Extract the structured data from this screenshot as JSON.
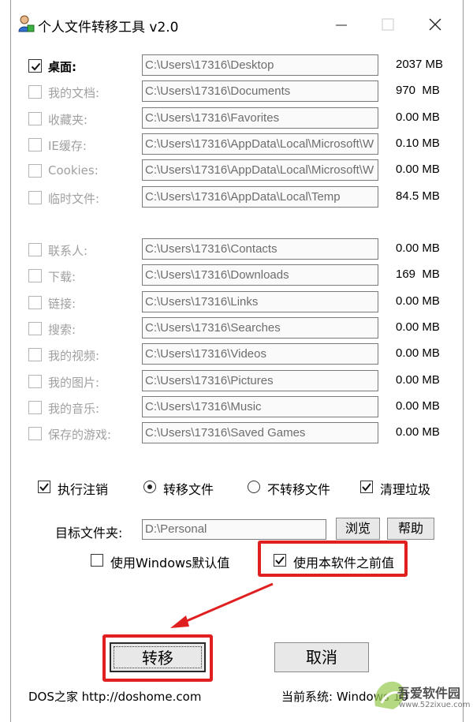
{
  "window": {
    "title": "个人文件转移工具 v2.0"
  },
  "folders_group1": [
    {
      "label": "桌面:",
      "path": "C:\\Users\\17316\\Desktop",
      "size": "2037 MB",
      "checked": true,
      "enabled": true
    },
    {
      "label": "我的文档:",
      "path": "C:\\Users\\17316\\Documents",
      "size": "970  MB",
      "checked": false,
      "enabled": false
    },
    {
      "label": "收藏夹:",
      "path": "C:\\Users\\17316\\Favorites",
      "size": "0.00 MB",
      "checked": false,
      "enabled": false
    },
    {
      "label": "IE缓存:",
      "path": "C:\\Users\\17316\\AppData\\Local\\Microsoft\\W",
      "size": "0.10 MB",
      "checked": false,
      "enabled": false
    },
    {
      "label": "Cookies:",
      "path": "C:\\Users\\17316\\AppData\\Local\\Microsoft\\W",
      "size": "0.00 MB",
      "checked": false,
      "enabled": false
    },
    {
      "label": "临时文件:",
      "path": "C:\\Users\\17316\\AppData\\Local\\Temp",
      "size": "84.5 MB",
      "checked": false,
      "enabled": false
    }
  ],
  "folders_group2": [
    {
      "label": "联系人:",
      "path": "C:\\Users\\17316\\Contacts",
      "size": "0.00 MB",
      "checked": false,
      "enabled": false
    },
    {
      "label": "下载:",
      "path": "C:\\Users\\17316\\Downloads",
      "size": "169  MB",
      "checked": false,
      "enabled": false
    },
    {
      "label": "链接:",
      "path": "C:\\Users\\17316\\Links",
      "size": "0.00 MB",
      "checked": false,
      "enabled": false
    },
    {
      "label": "搜索:",
      "path": "C:\\Users\\17316\\Searches",
      "size": "0.00 MB",
      "checked": false,
      "enabled": false
    },
    {
      "label": "我的视频:",
      "path": "C:\\Users\\17316\\Videos",
      "size": "0.00 MB",
      "checked": false,
      "enabled": false
    },
    {
      "label": "我的图片:",
      "path": "C:\\Users\\17316\\Pictures",
      "size": "0.00 MB",
      "checked": false,
      "enabled": false
    },
    {
      "label": "我的音乐:",
      "path": "C:\\Users\\17316\\Music",
      "size": "0.00 MB",
      "checked": false,
      "enabled": false
    },
    {
      "label": "保存的游戏:",
      "path": "C:\\Users\\17316\\Saved Games",
      "size": "0.00 MB",
      "checked": false,
      "enabled": false
    }
  ],
  "options": {
    "logoff_label": "执行注销",
    "logoff_checked": true,
    "move_files_label": "转移文件",
    "move_files_selected": true,
    "no_move_label": "不转移文件",
    "no_move_selected": false,
    "cleanup_label": "清理垃圾",
    "cleanup_checked": true
  },
  "target": {
    "label": "目标文件夹:",
    "value": "D:\\Personal",
    "browse_label": "浏览",
    "help_label": "帮助"
  },
  "defaults": {
    "windows_default_label": "使用Windows默认值",
    "windows_default_checked": false,
    "previous_label": "使用本软件之前值",
    "previous_checked": true
  },
  "actions": {
    "transfer_label": "转移",
    "cancel_label": "取消"
  },
  "footer": {
    "left": "DOS之家  http://doshome.com",
    "right": "当前系统:  Windows 10"
  },
  "watermark": {
    "text": "吾爱软件园",
    "url": "www.52zixue.com"
  },
  "colors": {
    "annotation_red": "#e02020",
    "disabled_text": "#a0a0a0"
  }
}
